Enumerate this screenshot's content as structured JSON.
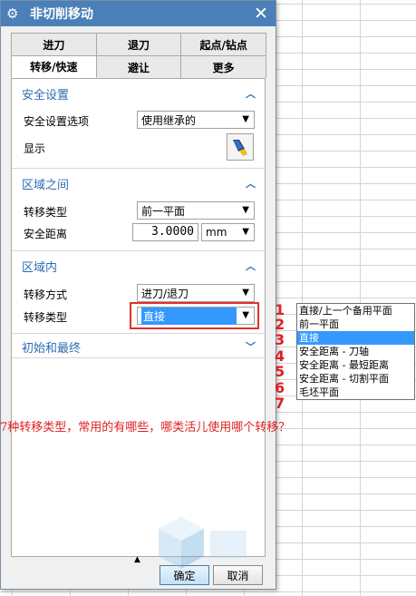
{
  "dialog": {
    "title": "非切削移动",
    "close": "✕"
  },
  "tabs": {
    "row1": [
      "进刀",
      "退刀",
      "起点/钻点"
    ],
    "row2": [
      "转移/快速",
      "避让",
      "更多"
    ],
    "active": "转移/快速"
  },
  "sections": {
    "safety": {
      "title": "安全设置",
      "option_label": "安全设置选项",
      "option_value": "使用继承的",
      "display_label": "显示"
    },
    "between": {
      "title": "区域之间",
      "type_label": "转移类型",
      "type_value": "前一平面",
      "distance_label": "安全距离",
      "distance_value": "3.0000",
      "unit_value": "mm"
    },
    "within": {
      "title": "区域内",
      "method_label": "转移方式",
      "method_value": "进刀/退刀",
      "type_label": "转移类型",
      "type_value": "直接"
    },
    "initial_final": {
      "title": "初始和最终"
    }
  },
  "dropdown": {
    "options": [
      "直接/上一个备用平面",
      "前一平面",
      "直接",
      "安全距离 - 刀轴",
      "安全距离 - 最短距离",
      "安全距离 - 切割平面",
      "毛坯平面"
    ],
    "selected": "直接"
  },
  "annotations": {
    "marks": [
      "1",
      "2",
      "3",
      "4",
      "5",
      "6",
      "7"
    ],
    "question": "7种转移类型，常用的有哪些，哪类活儿使用哪个转移？"
  },
  "buttons": {
    "ok": "确定",
    "cancel": "取消"
  },
  "colors": {
    "titlebar": "#4a7fb8",
    "section": "#2d6cb2",
    "selection": "#3399ff",
    "annotation": "#e02020"
  }
}
